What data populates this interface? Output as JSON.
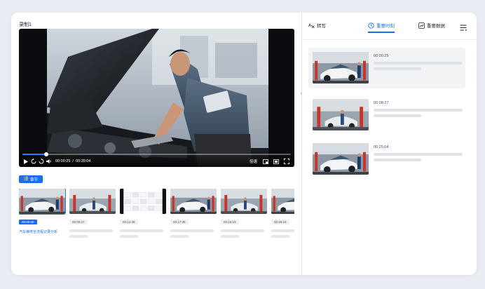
{
  "recording": {
    "title": "录制1"
  },
  "player": {
    "current_time": "00:00:25",
    "separator": "/",
    "duration": "00:35:04",
    "speed_label": "倍速",
    "progress_fraction": 0.09
  },
  "chapters": {
    "button_label": "章节",
    "items": [
      {
        "time": "00:00:25",
        "caption": "汽车维修全流程记录分析",
        "active": true,
        "scene": "garage-car"
      },
      {
        "time": "00:00:27",
        "caption": "",
        "active": false,
        "scene": "workshop"
      },
      {
        "time": "00:12:45",
        "caption": "",
        "active": false,
        "scene": "document"
      },
      {
        "time": "00:17:35",
        "caption": "",
        "active": false,
        "scene": "garage-car"
      },
      {
        "time": "00:15:15",
        "caption": "",
        "active": false,
        "scene": "workshop"
      },
      {
        "time": "00:26:15",
        "caption": "",
        "active": false,
        "scene": "garage-car"
      }
    ]
  },
  "tabs": {
    "items": [
      {
        "label": "转写",
        "icon": "transcript-icon",
        "active": false
      },
      {
        "label": "重要时刻",
        "icon": "key-moment-icon",
        "active": true
      },
      {
        "label": "重要数据",
        "icon": "chart-icon",
        "active": false
      }
    ]
  },
  "moments": [
    {
      "time": "00:00:25",
      "active": true
    },
    {
      "time": "00:08:27",
      "active": false
    },
    {
      "time": "00:25:04",
      "active": false
    }
  ],
  "colors": {
    "accent": "#1d6cf0",
    "background": "#e9edf3"
  }
}
